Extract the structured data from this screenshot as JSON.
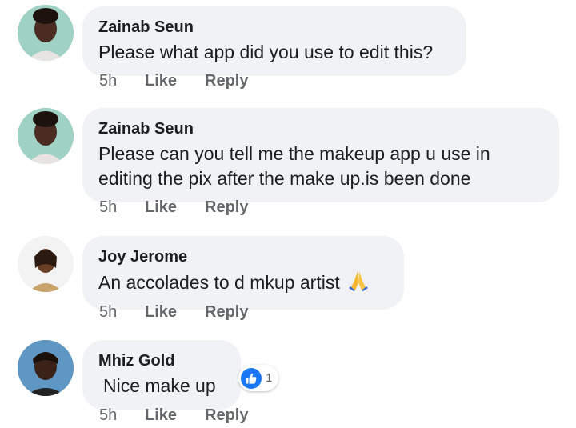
{
  "comments": [
    {
      "author": "Zainab Seun",
      "text": "Please what app did you use to edit this?",
      "time": "5h",
      "like": "Like",
      "reply": "Reply"
    },
    {
      "author": "Zainab Seun",
      "text": "Please can you tell me the makeup app u use in editing the pix after the make up.is been done",
      "time": "5h",
      "like": "Like",
      "reply": "Reply"
    },
    {
      "author": "Joy Jerome",
      "text": "An accolades to d mkup artist",
      "emoji": "folded-hands-icon",
      "time": "5h",
      "like": "Like",
      "reply": "Reply"
    },
    {
      "author": "Mhiz Gold",
      "text": "Nice make up",
      "time": "5h",
      "like": "Like",
      "reply": "Reply",
      "reaction": {
        "icon": "thumbs-up-icon",
        "count": "1"
      }
    }
  ],
  "colors": {
    "bubble": "#f0f2f5",
    "like_blue": "#1877f2",
    "meta": "#65676b"
  }
}
